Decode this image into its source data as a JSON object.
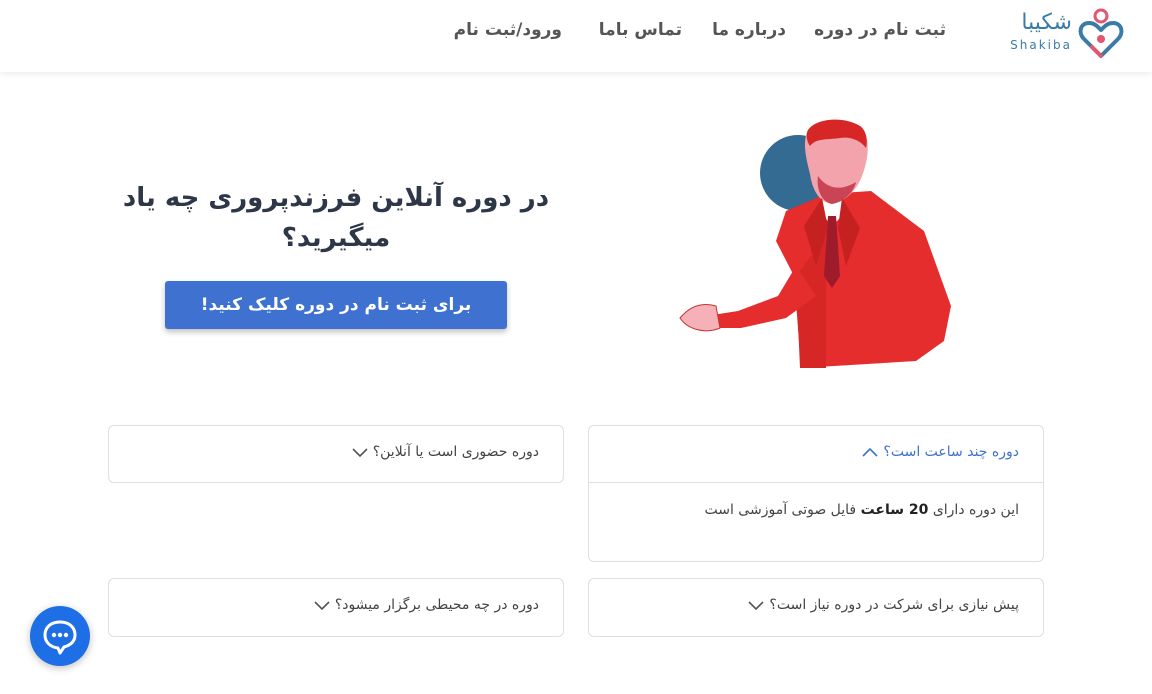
{
  "brand": {
    "name_fa": "شکیبا",
    "name_en": "Shakiba",
    "accent": "#3a7ca5",
    "heart": "#e2576e"
  },
  "nav": {
    "register": "ثبت نام در دوره",
    "about": "درباره ما",
    "contact": "تماس باما",
    "login": "ورود/ثبت نام"
  },
  "hero": {
    "title": "در دوره آنلاین فرزندپروری چه یاد میگیرید؟",
    "cta": "برای ثبت نام در دوره کلیک کنید!",
    "cta_color": "#3f72d0"
  },
  "faq": {
    "q1": "دوره چند ساعت است؟",
    "a1_prefix": "این دوره دارای",
    "a1_bold": "20 ساعت",
    "a1_suffix": "فایل صوتی آموزشی است",
    "q2": "دوره حضوری است یا آنلاین؟",
    "q3": "پیش نیازی برای شرکت در دوره نیاز است؟",
    "q4": "دوره در چه محیطی برگزار میشود؟"
  },
  "icons": {
    "logo": "heart-person-icon",
    "chevron_up": "chevron-up-icon",
    "chevron_down": "chevron-down-icon",
    "chat": "chat-bubble-icon"
  }
}
